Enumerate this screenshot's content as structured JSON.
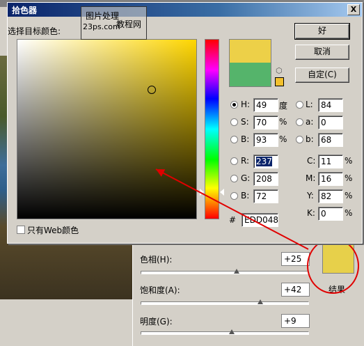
{
  "dialog": {
    "title": "拾色器",
    "close_label": "X",
    "select_label": "选择目标颜色:",
    "watermark": {
      "line1": "图片处理",
      "line2": "23ps.com",
      "line3": "教程网"
    },
    "buttons": {
      "ok": "好",
      "cancel": "取消",
      "custom": "自定(C)"
    },
    "web_only_label": "只有Web颜色",
    "hash_label": "#",
    "hex_value": "EDD048",
    "colors": {
      "new": "#edd048",
      "old": "#55b46b",
      "websafe": "#f2c02d"
    },
    "hsb": [
      {
        "label": "H:",
        "value": "49",
        "unit": "度"
      },
      {
        "label": "S:",
        "value": "70",
        "unit": "%"
      },
      {
        "label": "B:",
        "value": "93",
        "unit": "%"
      }
    ],
    "rgb": [
      {
        "label": "R:",
        "value": "237"
      },
      {
        "label": "G:",
        "value": "208"
      },
      {
        "label": "B:",
        "value": "72"
      }
    ],
    "lab": [
      {
        "label": "L:",
        "value": "84"
      },
      {
        "label": "a:",
        "value": "0"
      },
      {
        "label": "b:",
        "value": "68"
      }
    ],
    "cmyk": [
      {
        "label": "C:",
        "value": "11",
        "unit": "%"
      },
      {
        "label": "M:",
        "value": "16",
        "unit": "%"
      },
      {
        "label": "Y:",
        "value": "82",
        "unit": "%"
      },
      {
        "label": "K:",
        "value": "0",
        "unit": "%"
      }
    ]
  },
  "adjustments": {
    "hue": {
      "label": "色相(H):",
      "value": "+25"
    },
    "saturation": {
      "label": "饱和度(A):",
      "value": "+42"
    },
    "lightness": {
      "label": "明度(G):",
      "value": "+9"
    },
    "result_label": "结果",
    "result_color": "#e7d04a"
  }
}
